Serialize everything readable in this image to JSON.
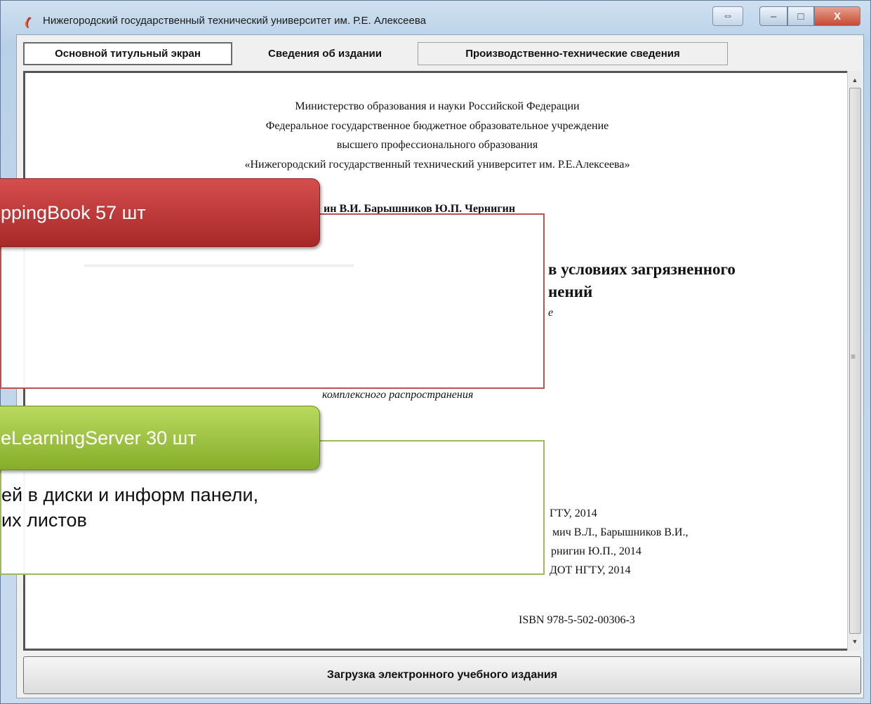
{
  "window": {
    "title": "Нижегородский государственный технический университет им. Р.Е. Алексеева",
    "controls": {
      "resize": "⇔",
      "minimize": "–",
      "maximize": "□",
      "close": "X"
    }
  },
  "tabs": [
    {
      "label": "Основной титульный экран",
      "active": true
    },
    {
      "label": "Сведения об издании",
      "active": false
    },
    {
      "label": "Производственно-технические сведения",
      "active": false
    }
  ],
  "paper": {
    "header1": "Министерство образования и науки Российской Федерации",
    "header2": "Федеральное государственное бюджетное образовательное учреждение",
    "header3": "высшего профессионального образования",
    "header4": "«Нижегородский государственный технический университет им. Р.Е.Алексеева»",
    "authors_fragment": "ин В.И. Барышников Ю.П. Чернигин",
    "title_fragment1": "в условиях загрязненного",
    "title_fragment2": "нений",
    "subtitle_fragment": "е",
    "distribution": "комплексного распространения",
    "copyright1": "ГТУ, 2014",
    "copyright2": "мич В.Л., Барышников В.И.,",
    "copyright3": "рнигин Ю.П., 2014",
    "copyright4": "ДОТ НГТУ, 2014",
    "isbn": "ISBN 978-5-502-00306-3"
  },
  "load_button": "Загрузка электронного учебного издания",
  "callouts": {
    "red_badge": "ppingBook 57 шт",
    "green_badge": "eLearningServer 30 шт",
    "green_text_line1": "ей в диски и информ панели,",
    "green_text_line2": "их листов"
  },
  "colors": {
    "red_accent": "#b83232",
    "green_accent": "#9bbb59",
    "window_frame": "#b9d1e8"
  }
}
